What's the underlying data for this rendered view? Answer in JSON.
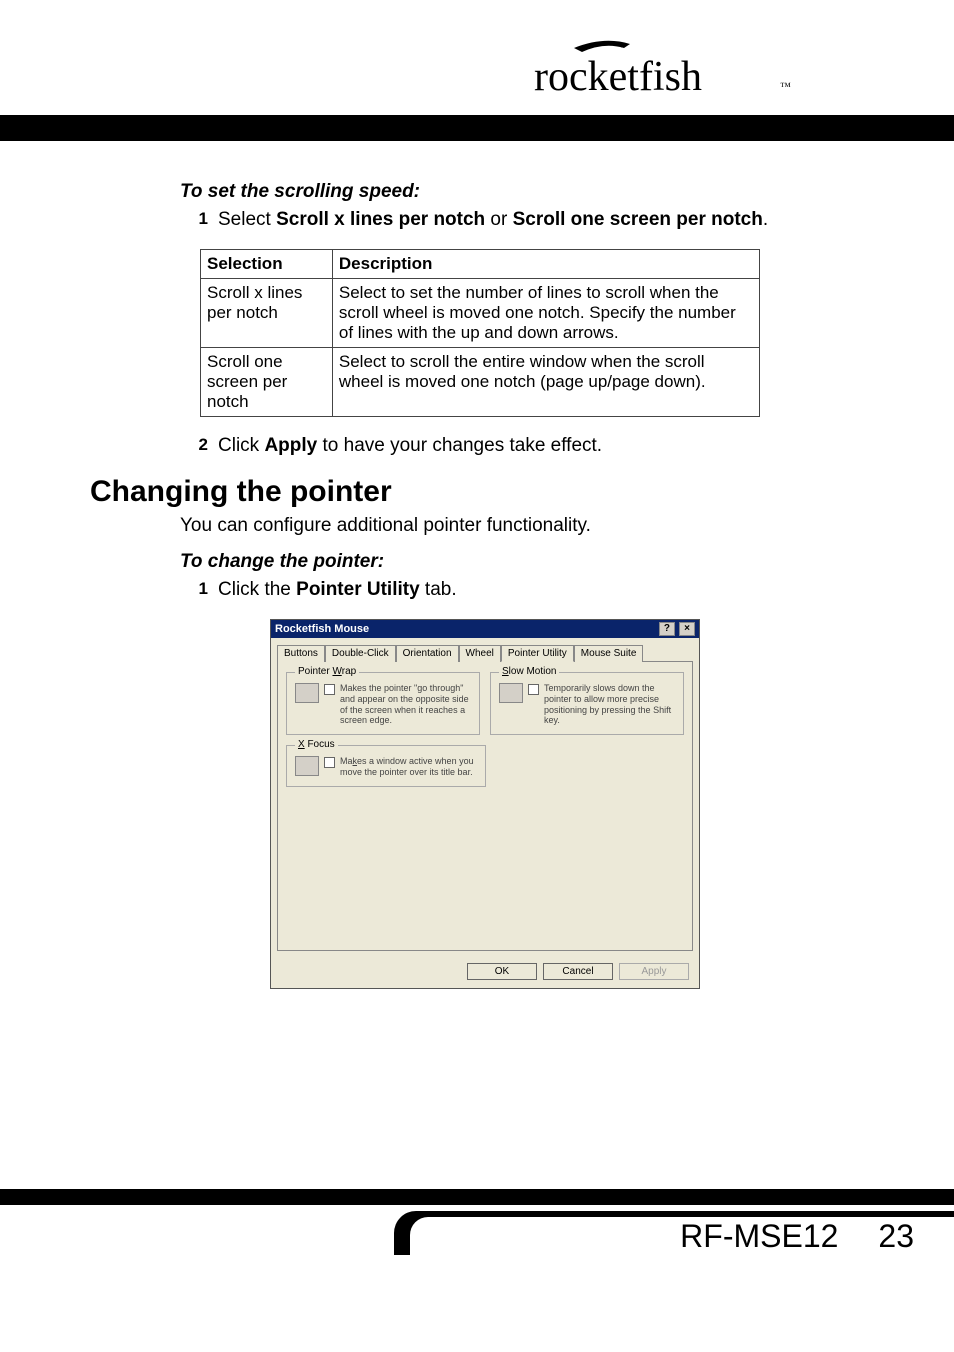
{
  "brand": "rocketfish",
  "section1": {
    "heading": "To set the scrolling speed:",
    "step1_num": "1",
    "step1_pre": "Select ",
    "step1_b1": "Scroll x lines per notch",
    "step1_mid": " or ",
    "step1_b2": "Scroll one screen per notch",
    "step1_post": ".",
    "table": {
      "h1": "Selection",
      "h2": "Description",
      "rows": [
        {
          "sel": "Scroll x lines per notch",
          "desc": "Select to set the number of lines to scroll when the scroll wheel is moved one notch. Specify the number of lines with the up and down arrows."
        },
        {
          "sel": "Scroll one screen per notch",
          "desc": "Select to scroll the entire window when the scroll wheel is moved one notch (page up/page down)."
        }
      ]
    },
    "step2_num": "2",
    "step2_pre": "Click ",
    "step2_b": "Apply",
    "step2_post": " to have your changes take effect."
  },
  "section2": {
    "heading": "Changing the pointer",
    "body": "You can configure additional pointer functionality.",
    "sub": "To change the pointer:",
    "step1_num": "1",
    "step1_pre": "Click the ",
    "step1_b": "Pointer Utility",
    "step1_post": " tab."
  },
  "dialog": {
    "title": "Rocketfish Mouse",
    "help": "?",
    "close": "×",
    "tabs": [
      "Buttons",
      "Double-Click",
      "Orientation",
      "Wheel",
      "Pointer Utility",
      "Mouse Suite"
    ],
    "active_tab_index": 4,
    "groups": {
      "wrap": {
        "legend_pre": "Pointer ",
        "legend_u": "W",
        "legend_post": "rap",
        "text": "Makes the pointer \"go through\" and appear on the opposite side of the screen when it reaches a screen edge."
      },
      "slow": {
        "legend_pre": "",
        "legend_u": "S",
        "legend_post": "low Motion",
        "text": "Temporarily slows down the pointer to allow more precise positioning by pressing the Shift key."
      },
      "xfocus": {
        "legend_u": "X",
        "legend_post": " Focus",
        "text_pre": "Ma",
        "text_u": "k",
        "text_post": "es a window active when you move the pointer over its title bar."
      }
    },
    "buttons": {
      "ok": "OK",
      "cancel": "Cancel",
      "apply": "Apply"
    }
  },
  "footer": {
    "model": "RF-MSE12",
    "page": "23"
  }
}
